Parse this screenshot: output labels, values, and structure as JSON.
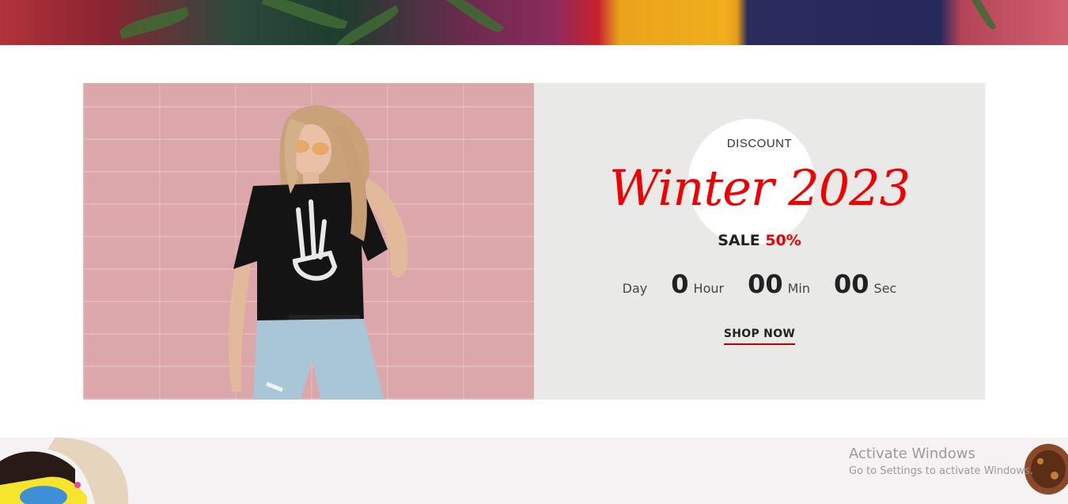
{
  "promo": {
    "discount_label": "DISCOUNT",
    "title": "Winter 2023",
    "sale_label": "SALE",
    "sale_percent": "50%",
    "countdown": {
      "day_label": "Day",
      "hours_value": "0",
      "hours_label": "Hour",
      "minutes_value": "00",
      "minutes_label": "Min",
      "seconds_value": "00",
      "seconds_label": "Sec"
    },
    "cta_label": "SHOP NOW"
  },
  "watermark": {
    "line1": "Activate Windows",
    "line2": "Go to Settings to activate Windows."
  },
  "colors": {
    "accent": "#f00000",
    "panel_bg": "#e9eae8",
    "photo_bg": "#dca7aa"
  }
}
